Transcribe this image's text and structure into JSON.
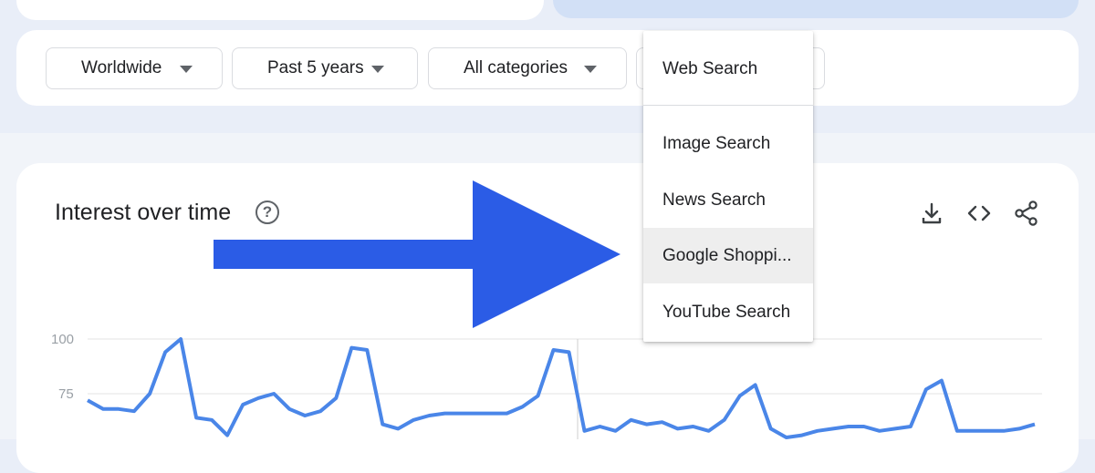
{
  "filters": {
    "region": "Worldwide",
    "time_range": "Past 5 years",
    "category": "All categories"
  },
  "search_type_menu": {
    "selected": "Web Search",
    "options": [
      "Image Search",
      "News Search",
      "Google Shoppi...",
      "YouTube Search"
    ],
    "highlighted": "Google Shoppi..."
  },
  "chart": {
    "title": "Interest over time",
    "tools": [
      "download-icon",
      "embed-code-icon",
      "share-icon"
    ]
  },
  "chart_data": {
    "type": "line",
    "title": "Interest over time",
    "xlabel": "",
    "ylabel": "",
    "y_ticks": [
      "100",
      "75"
    ],
    "ylim": [
      57,
      100
    ],
    "grid": true,
    "series": [
      {
        "color": "#4a86e8",
        "values": [
          72,
          68,
          68,
          67,
          75,
          94,
          100,
          64,
          63,
          56,
          70,
          73,
          75,
          68,
          65,
          67,
          73,
          96,
          95,
          61,
          59,
          63,
          65,
          66,
          66,
          66,
          66,
          66,
          69,
          74,
          95,
          94,
          58,
          60,
          58,
          63,
          61,
          62,
          59,
          60,
          58,
          63,
          74,
          79,
          59,
          55,
          56,
          58,
          59,
          60,
          60,
          58,
          59,
          60,
          77,
          81,
          58,
          58,
          58,
          58,
          59,
          61
        ]
      }
    ]
  },
  "colors": {
    "accent_arrow": "#2b5ce6",
    "line": "#4a86e8",
    "menu_highlight": "#eeeeee"
  }
}
